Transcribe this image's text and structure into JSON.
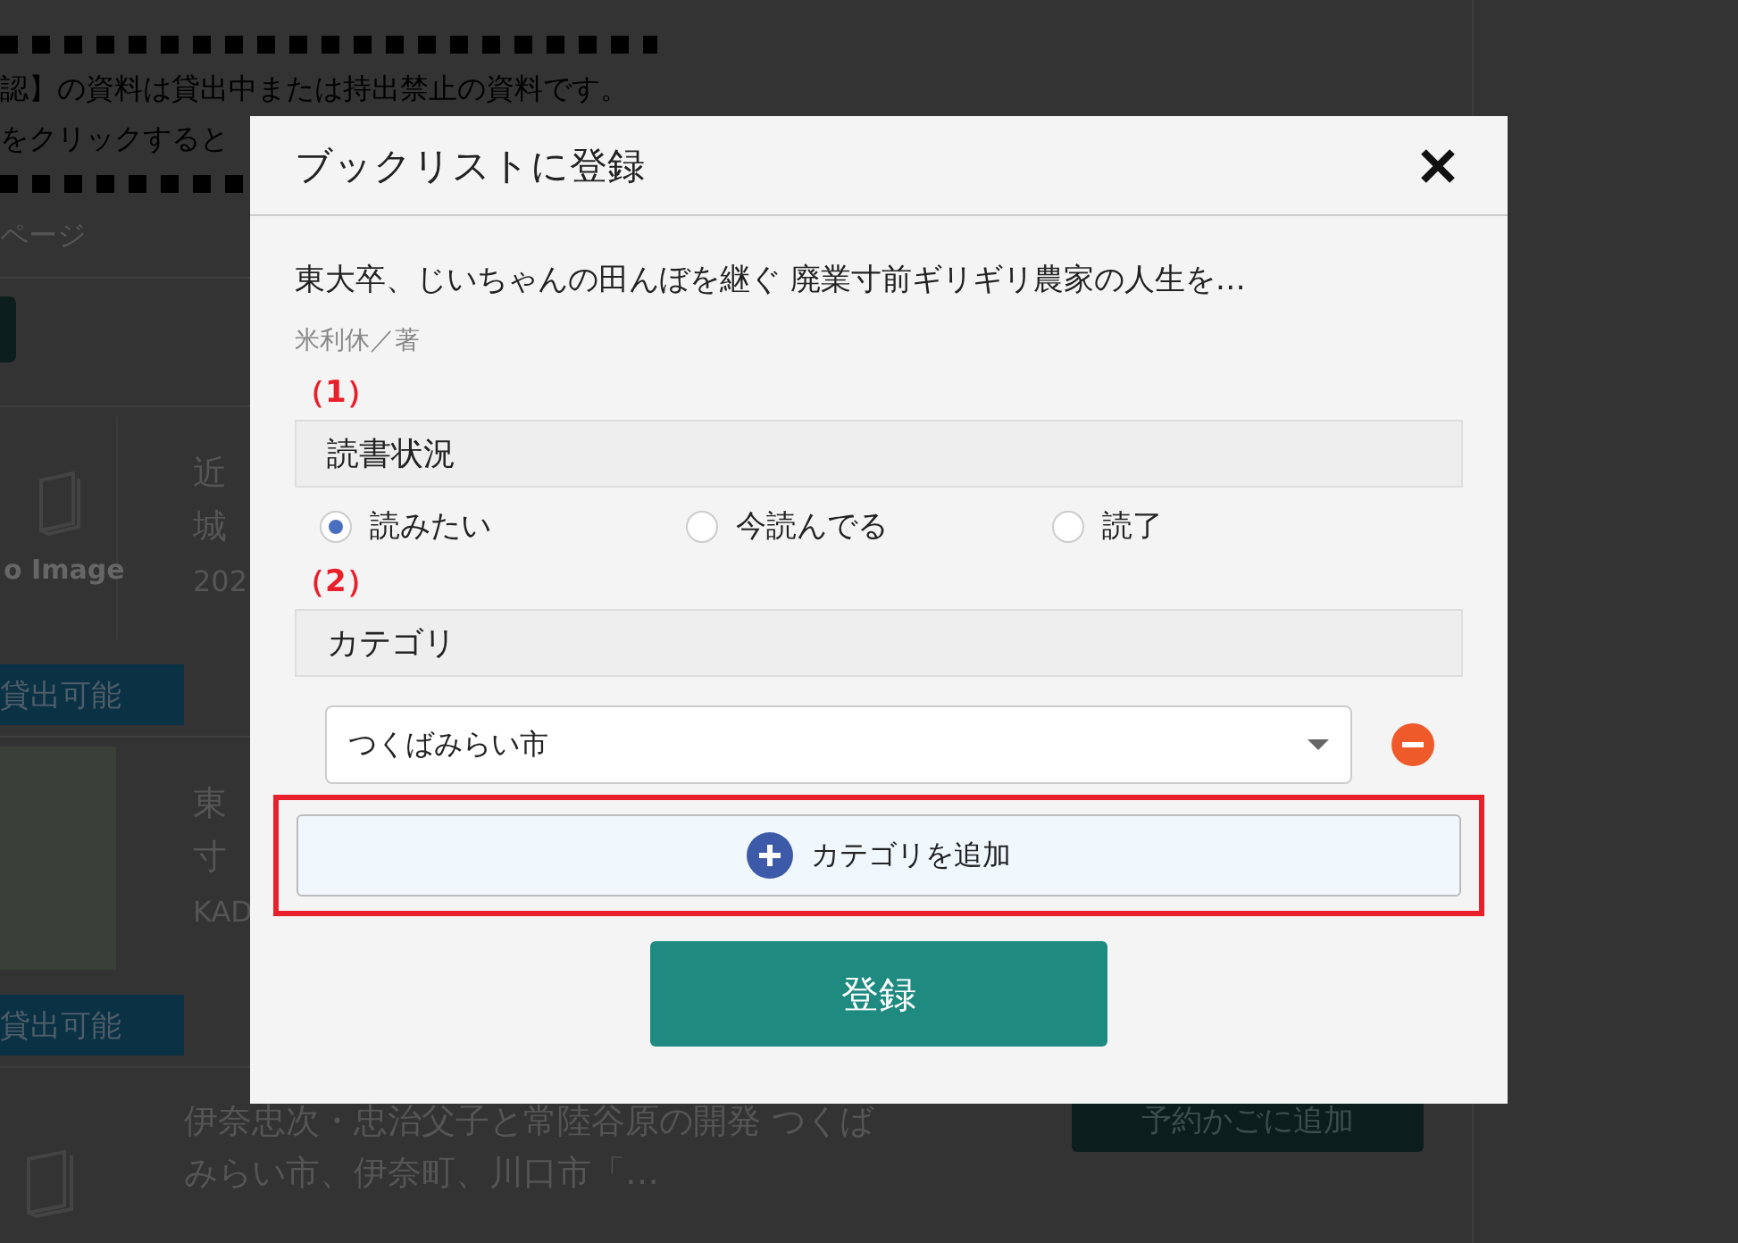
{
  "background": {
    "notice_lines": [
      "認】の資料は貸出中または持出禁止の資料です。",
      "をクリックすると"
    ],
    "page_label": "ページ",
    "results": [
      {
        "kind": "no-image",
        "cover_text": "o Image",
        "title_lines": [
          "近",
          "城"
        ],
        "meta": "202",
        "status": "貸出可能"
      },
      {
        "kind": "cover",
        "title_lines": [
          "東",
          "寸"
        ],
        "meta": "KAD",
        "status": "貸出可能"
      },
      {
        "kind": "no-image",
        "title": "伊奈忠次・忠治父子と常陸谷原の開発 つくばみらい市、伊奈町、川口市「…",
        "button": "予約かごに追加"
      }
    ]
  },
  "dialog": {
    "title": "ブックリストに登録",
    "book_title": "東大卒、じいちゃんの田んぼを継ぐ 廃業寸前ギリギリ農家の人生を…",
    "author": "米利休／著",
    "sections": [
      {
        "kind": "radios",
        "number": "（1）",
        "heading": "読書状況",
        "options": [
          {
            "label": "読みたい",
            "selected": true
          },
          {
            "label": "今読んでる",
            "selected": false
          },
          {
            "label": "読了",
            "selected": false
          }
        ]
      },
      {
        "kind": "categories",
        "number": "（2）",
        "heading": "カテゴリ",
        "categories": [
          {
            "value": "つくばみらい市"
          }
        ],
        "add_button": "カテゴリを追加",
        "highlighted": true
      }
    ],
    "submit": "登録"
  }
}
